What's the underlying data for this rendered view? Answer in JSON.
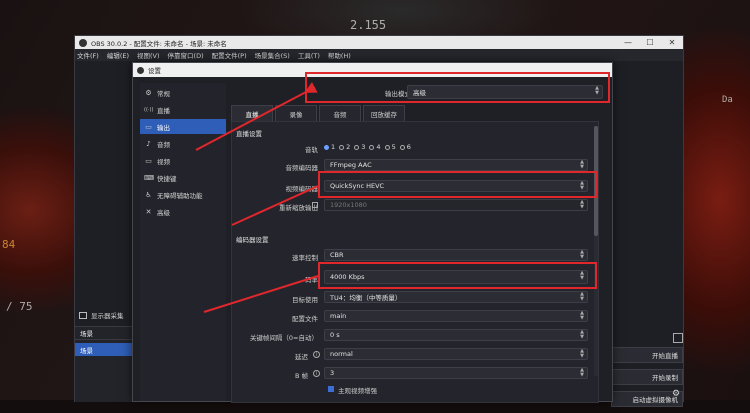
{
  "background": {
    "text_top": "2.155",
    "text_left_1": "84",
    "text_left_2": "/ 75",
    "text_right": "Da"
  },
  "obs": {
    "title": "OBS 30.0.2 - 配置文件: 未命名 - 场景: 未命名",
    "window_controls": [
      "—",
      "☐",
      "✕"
    ],
    "menu": [
      "文件(F)",
      "编辑(E)",
      "视图(V)",
      "停靠窗口(D)",
      "配置文件(P)",
      "场景集合(S)",
      "工具(T)",
      "帮助(H)"
    ],
    "preview_dock_label": "显示器采集",
    "scenes_header": "场景",
    "scenes": [
      "场景"
    ],
    "controls": [
      "开始直播",
      "开始录制",
      "启动虚拟摄像机"
    ]
  },
  "settings": {
    "title": "设置",
    "nav": [
      {
        "icon": "⚙",
        "label": "常规"
      },
      {
        "icon": "((·))",
        "label": "直播"
      },
      {
        "icon": "▭",
        "label": "输出"
      },
      {
        "icon": "♪",
        "label": "音频"
      },
      {
        "icon": "▭",
        "label": "视频"
      },
      {
        "icon": "⌨",
        "label": "快捷键"
      },
      {
        "icon": "♿",
        "label": "无障碍辅助功能"
      },
      {
        "icon": "✕",
        "label": "高级"
      }
    ],
    "active_nav": 2,
    "output_mode_label": "输出模式",
    "output_mode_value": "高级",
    "tabs": [
      "直播",
      "录像",
      "音频",
      "回放缓存"
    ],
    "section_streaming": "直播设置",
    "audio_track_label": "音轨",
    "audio_tracks": [
      "1",
      "2",
      "3",
      "4",
      "5",
      "6"
    ],
    "audio_encoder_label": "音频编码器",
    "audio_encoder_value": "FFmpeg AAC",
    "video_encoder_label": "视频编码器",
    "video_encoder_value": "QuickSync HEVC",
    "rescale_label": "重新缩放输出",
    "rescale_value": "1920x1080",
    "section_encoder": "编码器设置",
    "rate_control_label": "速率控制",
    "rate_control_value": "CBR",
    "bitrate_label": "码率",
    "bitrate_value": "4000 Kbps",
    "target_usage_label": "目标使用",
    "target_usage_value": "TU4：均衡（中等质量）",
    "profile_label": "配置文件",
    "profile_value": "main",
    "keyframe_label": "关键帧间隔（0=自动）",
    "keyframe_value": "0 s",
    "latency_label": "延迟",
    "latency_value": "normal",
    "bframes_label": "B 帧",
    "bframes_value": "3",
    "subjective_label": "主观视频增强"
  },
  "highlight_color": "#e0272c"
}
